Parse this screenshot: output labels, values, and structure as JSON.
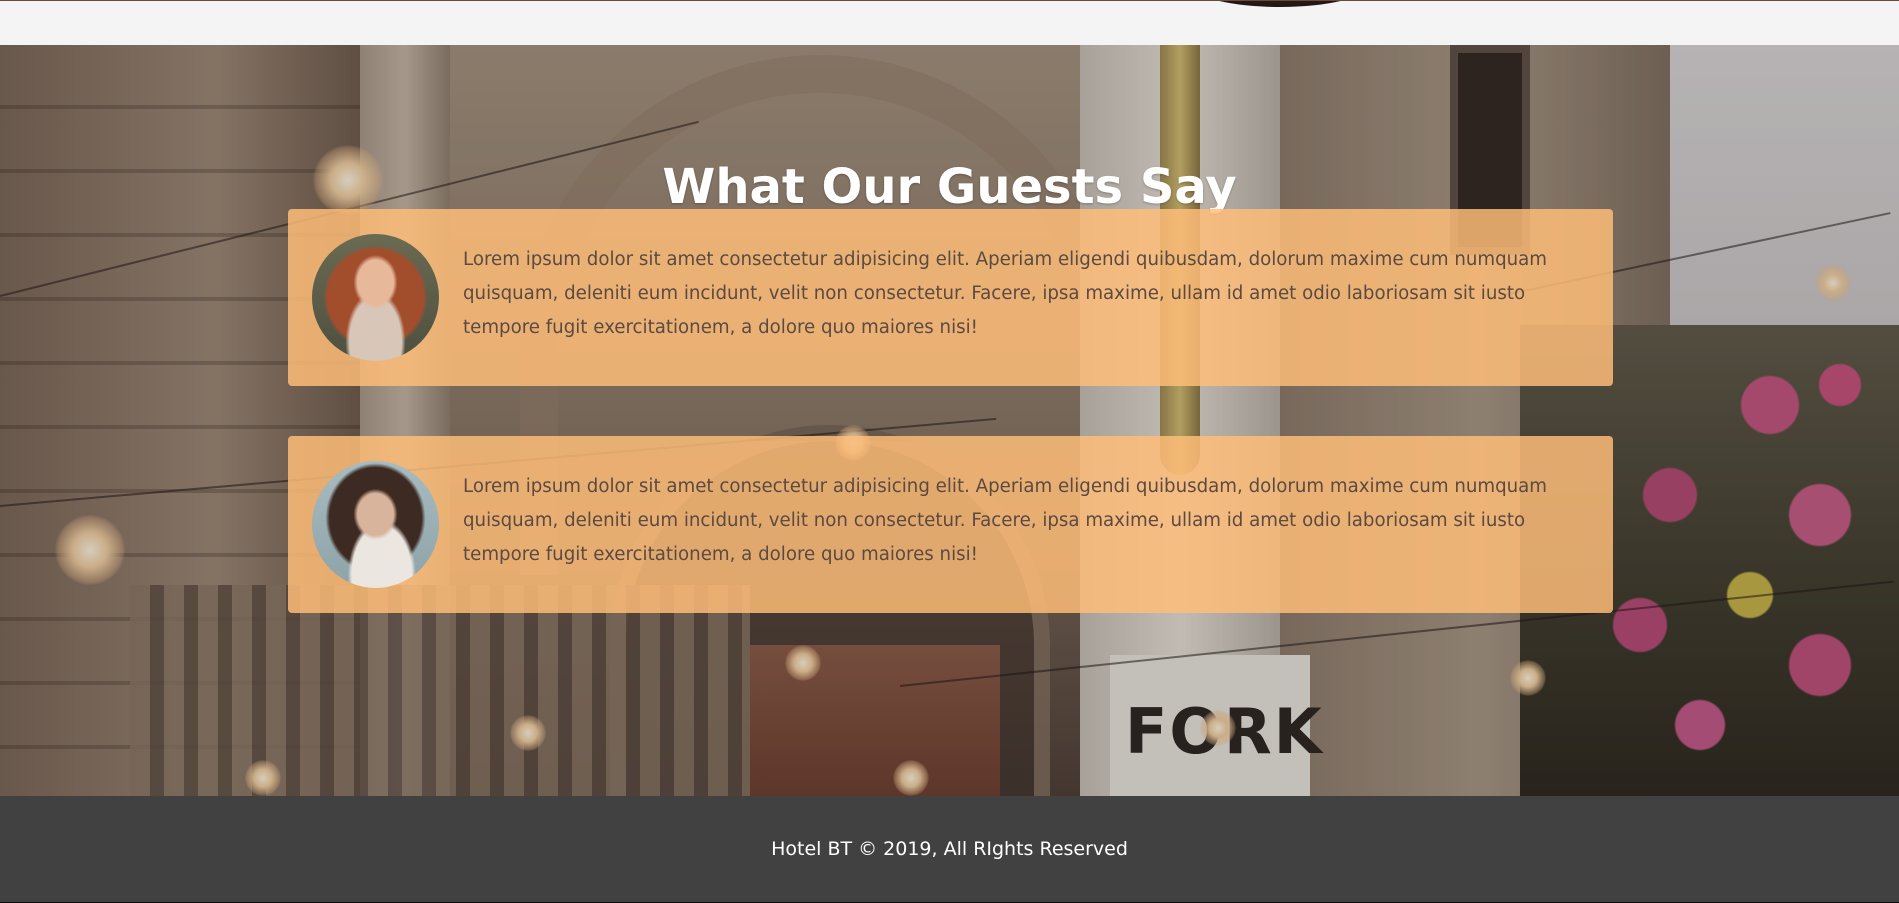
{
  "section": {
    "title": "What Our Guests Say"
  },
  "testimonials": [
    {
      "avatar": "guest-woman-red-hair-photo",
      "text": "Lorem ipsum dolor sit amet consectetur adipisicing elit. Aperiam eligendi quibusdam, dolorum maxime cum numquam quisquam, deleniti eum incidunt, velit non consectetur. Facere, ipsa maxime, ullam id amet odio laboriosam sit iusto tempore fugit exercitationem, a dolore quo maiores nisi!"
    },
    {
      "avatar": "guest-woman-dark-hair-photo",
      "text": "Lorem ipsum dolor sit amet consectetur adipisicing elit. Aperiam eligendi quibusdam, dolorum maxime cum numquam quisquam, deleniti eum incidunt, velit non consectetur. Facere, ipsa maxime, ullam id amet odio laboriosam sit iusto tempore fugit exercitationem, a dolore quo maiores nisi!"
    }
  ],
  "background": {
    "sign_text": "FORK"
  },
  "footer": {
    "text": "Hotel BT © 2019, All RIghts Reserved"
  },
  "colors": {
    "card_background": "#ffbd78",
    "footer_background": "#414142",
    "title_color": "#ffffff"
  }
}
